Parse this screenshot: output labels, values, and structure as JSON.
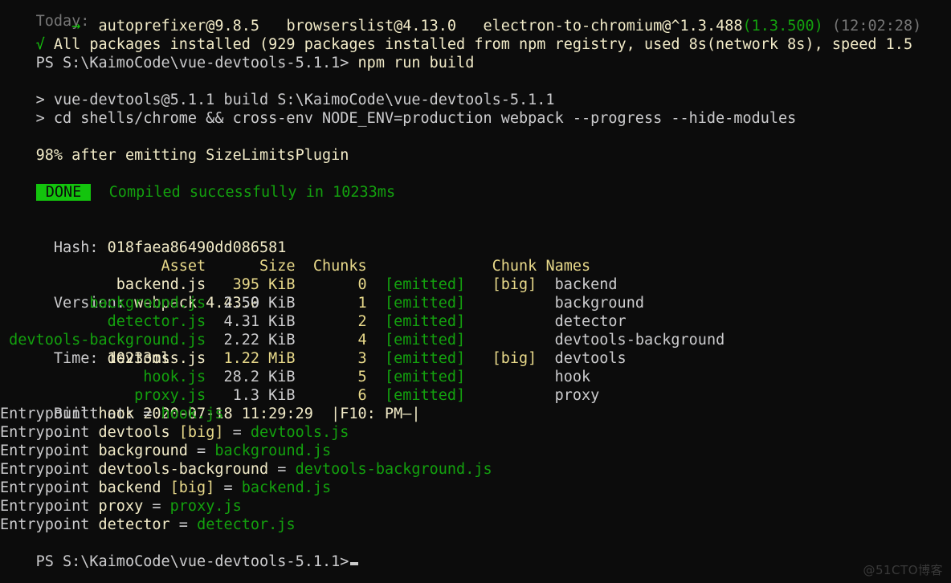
{
  "terminal": {
    "background_color": "#0c0c0c",
    "default_text_color": "#ccccce",
    "green_color": "#13a10e",
    "yellow_color": "#e8d98a",
    "cream_color": "#f2ebc8",
    "gray_color": "#767676",
    "done_badge_bg": "#13c40d",
    "watermark": "@51CTO博客"
  },
  "scrollback": {
    "today_label": "Today:",
    "install_summary": {
      "arrow": "→",
      "pkg1": "autoprefixer@9.8.5",
      "pkg2": "browserslist@4.13.0",
      "pkg3_name": "electron-to-chromium@^1.3.488",
      "pkg3_resolved": "(1.3.500)",
      "elapsed": "(12:02:28)"
    },
    "all_installed": {
      "check": "√",
      "text": "All packages installed (929 packages installed from npm registry, used 8s(network 8s), speed 1.5"
    }
  },
  "prompt_run": {
    "prefix": "PS ",
    "path": "S:\\KaimoCode\\vue-devtools-5.1.1>",
    "command": " npm run build"
  },
  "npm_script": {
    "line1": "> vue-devtools@5.1.1 build S:\\KaimoCode\\vue-devtools-5.1.1",
    "line2": "> cd shells/chrome && cross-env NODE_ENV=production webpack --progress --hide-modules"
  },
  "progress": {
    "text": "98% after emitting SizeLimitsPlugin"
  },
  "done": {
    "badge": " DONE ",
    "message": "  Compiled successfully in 10233ms"
  },
  "build_meta": [
    {
      "label": "Hash: ",
      "value": "018faea86490dd086581"
    },
    {
      "label": "Version: ",
      "value": "webpack 4.43.0"
    },
    {
      "label": "Time: ",
      "value": "10233ms"
    },
    {
      "label": "Built at: ",
      "value": "2020-07-18 11:29:29  |F10: PM—|"
    }
  ],
  "assets_table": {
    "headers": {
      "asset": "Asset",
      "size": "Size",
      "chunks": "Chunks",
      "chunk_names": "Chunk Names"
    },
    "rows": [
      {
        "asset": "backend.js",
        "asset_big": true,
        "size": "395 KiB",
        "size_big": true,
        "chunk": "0",
        "emitted": "[emitted]",
        "big": "[big]",
        "chunk_name": "backend"
      },
      {
        "asset": "background.js",
        "asset_big": false,
        "size": "2.59 KiB",
        "size_big": false,
        "chunk": "1",
        "emitted": "[emitted]",
        "big": "",
        "chunk_name": "background"
      },
      {
        "asset": "detector.js",
        "asset_big": false,
        "size": "4.31 KiB",
        "size_big": false,
        "chunk": "2",
        "emitted": "[emitted]",
        "big": "",
        "chunk_name": "detector"
      },
      {
        "asset": "devtools-background.js",
        "asset_big": false,
        "size": "2.22 KiB",
        "size_big": false,
        "chunk": "4",
        "emitted": "[emitted]",
        "big": "",
        "chunk_name": "devtools-background"
      },
      {
        "asset": "devtools.js",
        "asset_big": true,
        "size": "1.22 MiB",
        "size_big": true,
        "chunk": "3",
        "emitted": "[emitted]",
        "big": "[big]",
        "chunk_name": "devtools"
      },
      {
        "asset": "hook.js",
        "asset_big": false,
        "size": "28.2 KiB",
        "size_big": false,
        "chunk": "5",
        "emitted": "[emitted]",
        "big": "",
        "chunk_name": "hook"
      },
      {
        "asset": "proxy.js",
        "asset_big": false,
        "size": "1.3 KiB",
        "size_big": false,
        "chunk": "6",
        "emitted": "[emitted]",
        "big": "",
        "chunk_name": "proxy"
      }
    ]
  },
  "entrypoints": [
    {
      "keyword": "Entrypoint ",
      "name": "hook",
      "big": "",
      "eq": " = ",
      "file": "hook.js"
    },
    {
      "keyword": "Entrypoint ",
      "name": "devtools",
      "big": "[big]",
      "eq": " = ",
      "file": "devtools.js"
    },
    {
      "keyword": "Entrypoint ",
      "name": "background",
      "big": "",
      "eq": " = ",
      "file": "background.js"
    },
    {
      "keyword": "Entrypoint ",
      "name": "devtools-background",
      "big": "",
      "eq": " = ",
      "file": "devtools-background.js"
    },
    {
      "keyword": "Entrypoint ",
      "name": "backend",
      "big": "[big]",
      "eq": " = ",
      "file": "backend.js"
    },
    {
      "keyword": "Entrypoint ",
      "name": "proxy",
      "big": "",
      "eq": " = ",
      "file": "proxy.js"
    },
    {
      "keyword": "Entrypoint ",
      "name": "detector",
      "big": "",
      "eq": " = ",
      "file": "detector.js"
    }
  ],
  "prompt_final": {
    "prefix": "PS ",
    "path": "S:\\KaimoCode\\vue-devtools-5.1.1>"
  }
}
